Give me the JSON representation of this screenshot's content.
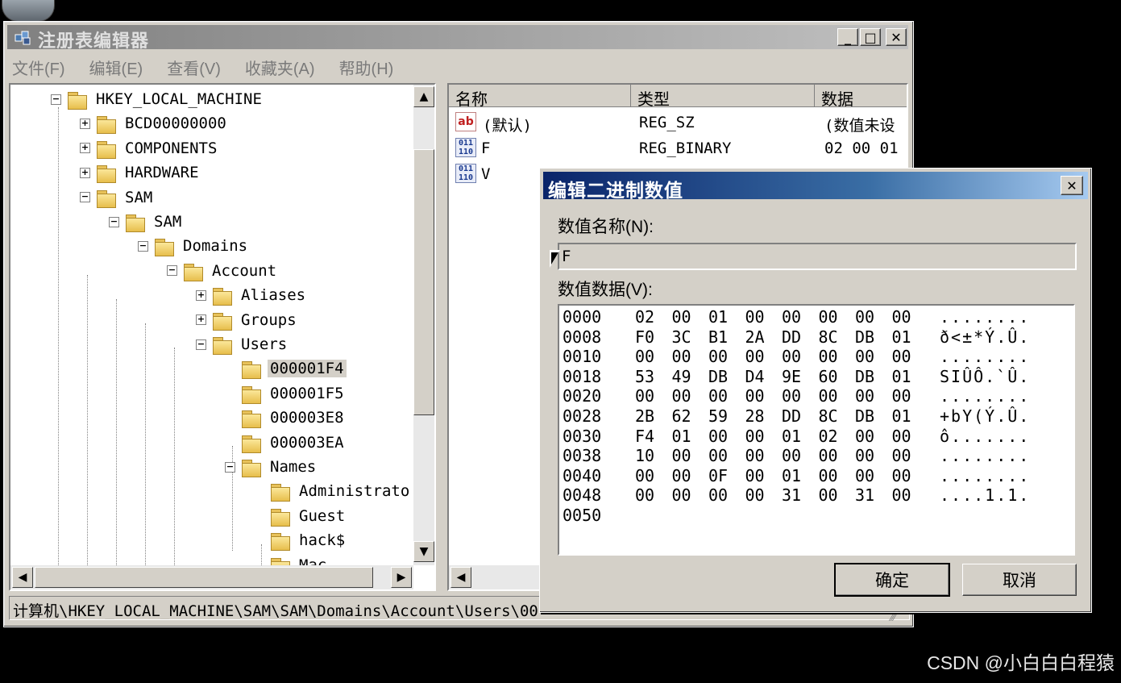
{
  "window": {
    "title": "注册表编辑器",
    "min_label": "_",
    "max_label": "□",
    "close_label": "✕"
  },
  "menu": [
    "文件(F)",
    "编辑(E)",
    "查看(V)",
    "收藏夹(A)",
    "帮助(H)"
  ],
  "tree": {
    "nodes": [
      {
        "label": "HKEY_LOCAL_MACHINE",
        "expander": "−"
      },
      {
        "label": "BCD00000000",
        "expander": "+"
      },
      {
        "label": "COMPONENTS",
        "expander": "+"
      },
      {
        "label": "HARDWARE",
        "expander": "+"
      },
      {
        "label": "SAM",
        "expander": "−"
      },
      {
        "label": "SAM",
        "expander": "−"
      },
      {
        "label": "Domains",
        "expander": "−"
      },
      {
        "label": "Account",
        "expander": "−"
      },
      {
        "label": "Aliases",
        "expander": "+"
      },
      {
        "label": "Groups",
        "expander": "+"
      },
      {
        "label": "Users",
        "expander": "−"
      },
      {
        "label": "000001F4",
        "expander": "",
        "selected": true
      },
      {
        "label": "000001F5",
        "expander": ""
      },
      {
        "label": "000003E8",
        "expander": ""
      },
      {
        "label": "000003EA",
        "expander": ""
      },
      {
        "label": "Names",
        "expander": "−"
      },
      {
        "label": "Administrato",
        "expander": ""
      },
      {
        "label": "Guest",
        "expander": ""
      },
      {
        "label": "hack$",
        "expander": ""
      },
      {
        "label": "Mac",
        "expander": ""
      }
    ]
  },
  "list": {
    "columns": [
      "名称",
      "类型",
      "数据"
    ],
    "rows": [
      {
        "icon": "string-value-icon",
        "name": "(默认)",
        "type": "REG_SZ",
        "data": "(数值未设"
      },
      {
        "icon": "binary-value-icon",
        "name": "F",
        "type": "REG_BINARY",
        "data": "02 00 01"
      },
      {
        "icon": "binary-value-icon",
        "name": "V",
        "type": "",
        "data": ""
      }
    ]
  },
  "status_path": "计算机\\HKEY_LOCAL_MACHINE\\SAM\\SAM\\Domains\\Account\\Users\\00",
  "dialog": {
    "title": "编辑二进制数值",
    "close_label": "✕",
    "name_label": "数值名称(N):",
    "name_value": "F",
    "data_label": "数值数据(V):",
    "hex_rows": [
      {
        "offset": "0000",
        "bytes": [
          "02",
          "00",
          "01",
          "00",
          "00",
          "00",
          "00",
          "00"
        ],
        "ascii": "........"
      },
      {
        "offset": "0008",
        "bytes": [
          "F0",
          "3C",
          "B1",
          "2A",
          "DD",
          "8C",
          "DB",
          "01"
        ],
        "ascii": "ð<±*Ý.Û."
      },
      {
        "offset": "0010",
        "bytes": [
          "00",
          "00",
          "00",
          "00",
          "00",
          "00",
          "00",
          "00"
        ],
        "ascii": "........"
      },
      {
        "offset": "0018",
        "bytes": [
          "53",
          "49",
          "DB",
          "D4",
          "9E",
          "60",
          "DB",
          "01"
        ],
        "ascii": "SIÛÔ.`Û."
      },
      {
        "offset": "0020",
        "bytes": [
          "00",
          "00",
          "00",
          "00",
          "00",
          "00",
          "00",
          "00"
        ],
        "ascii": "........"
      },
      {
        "offset": "0028",
        "bytes": [
          "2B",
          "62",
          "59",
          "28",
          "DD",
          "8C",
          "DB",
          "01"
        ],
        "ascii": "+bY(Ý.Û."
      },
      {
        "offset": "0030",
        "bytes": [
          "F4",
          "01",
          "00",
          "00",
          "01",
          "02",
          "00",
          "00"
        ],
        "ascii": "ô......."
      },
      {
        "offset": "0038",
        "bytes": [
          "10",
          "00",
          "00",
          "00",
          "00",
          "00",
          "00",
          "00"
        ],
        "ascii": "........"
      },
      {
        "offset": "0040",
        "bytes": [
          "00",
          "00",
          "0F",
          "00",
          "01",
          "00",
          "00",
          "00"
        ],
        "ascii": "........"
      },
      {
        "offset": "0048",
        "bytes": [
          "00",
          "00",
          "00",
          "00",
          "31",
          "00",
          "31",
          "00"
        ],
        "ascii": "....1.1."
      },
      {
        "offset": "0050",
        "bytes": [],
        "ascii": ""
      }
    ],
    "ok_label": "确定",
    "cancel_label": "取消"
  },
  "watermark": "CSDN @小白白白程猿",
  "colors": {
    "dialog_title_start": "#0a246a",
    "dialog_title_end": "#a6caf0",
    "window_bg": "#d4d0c8"
  }
}
